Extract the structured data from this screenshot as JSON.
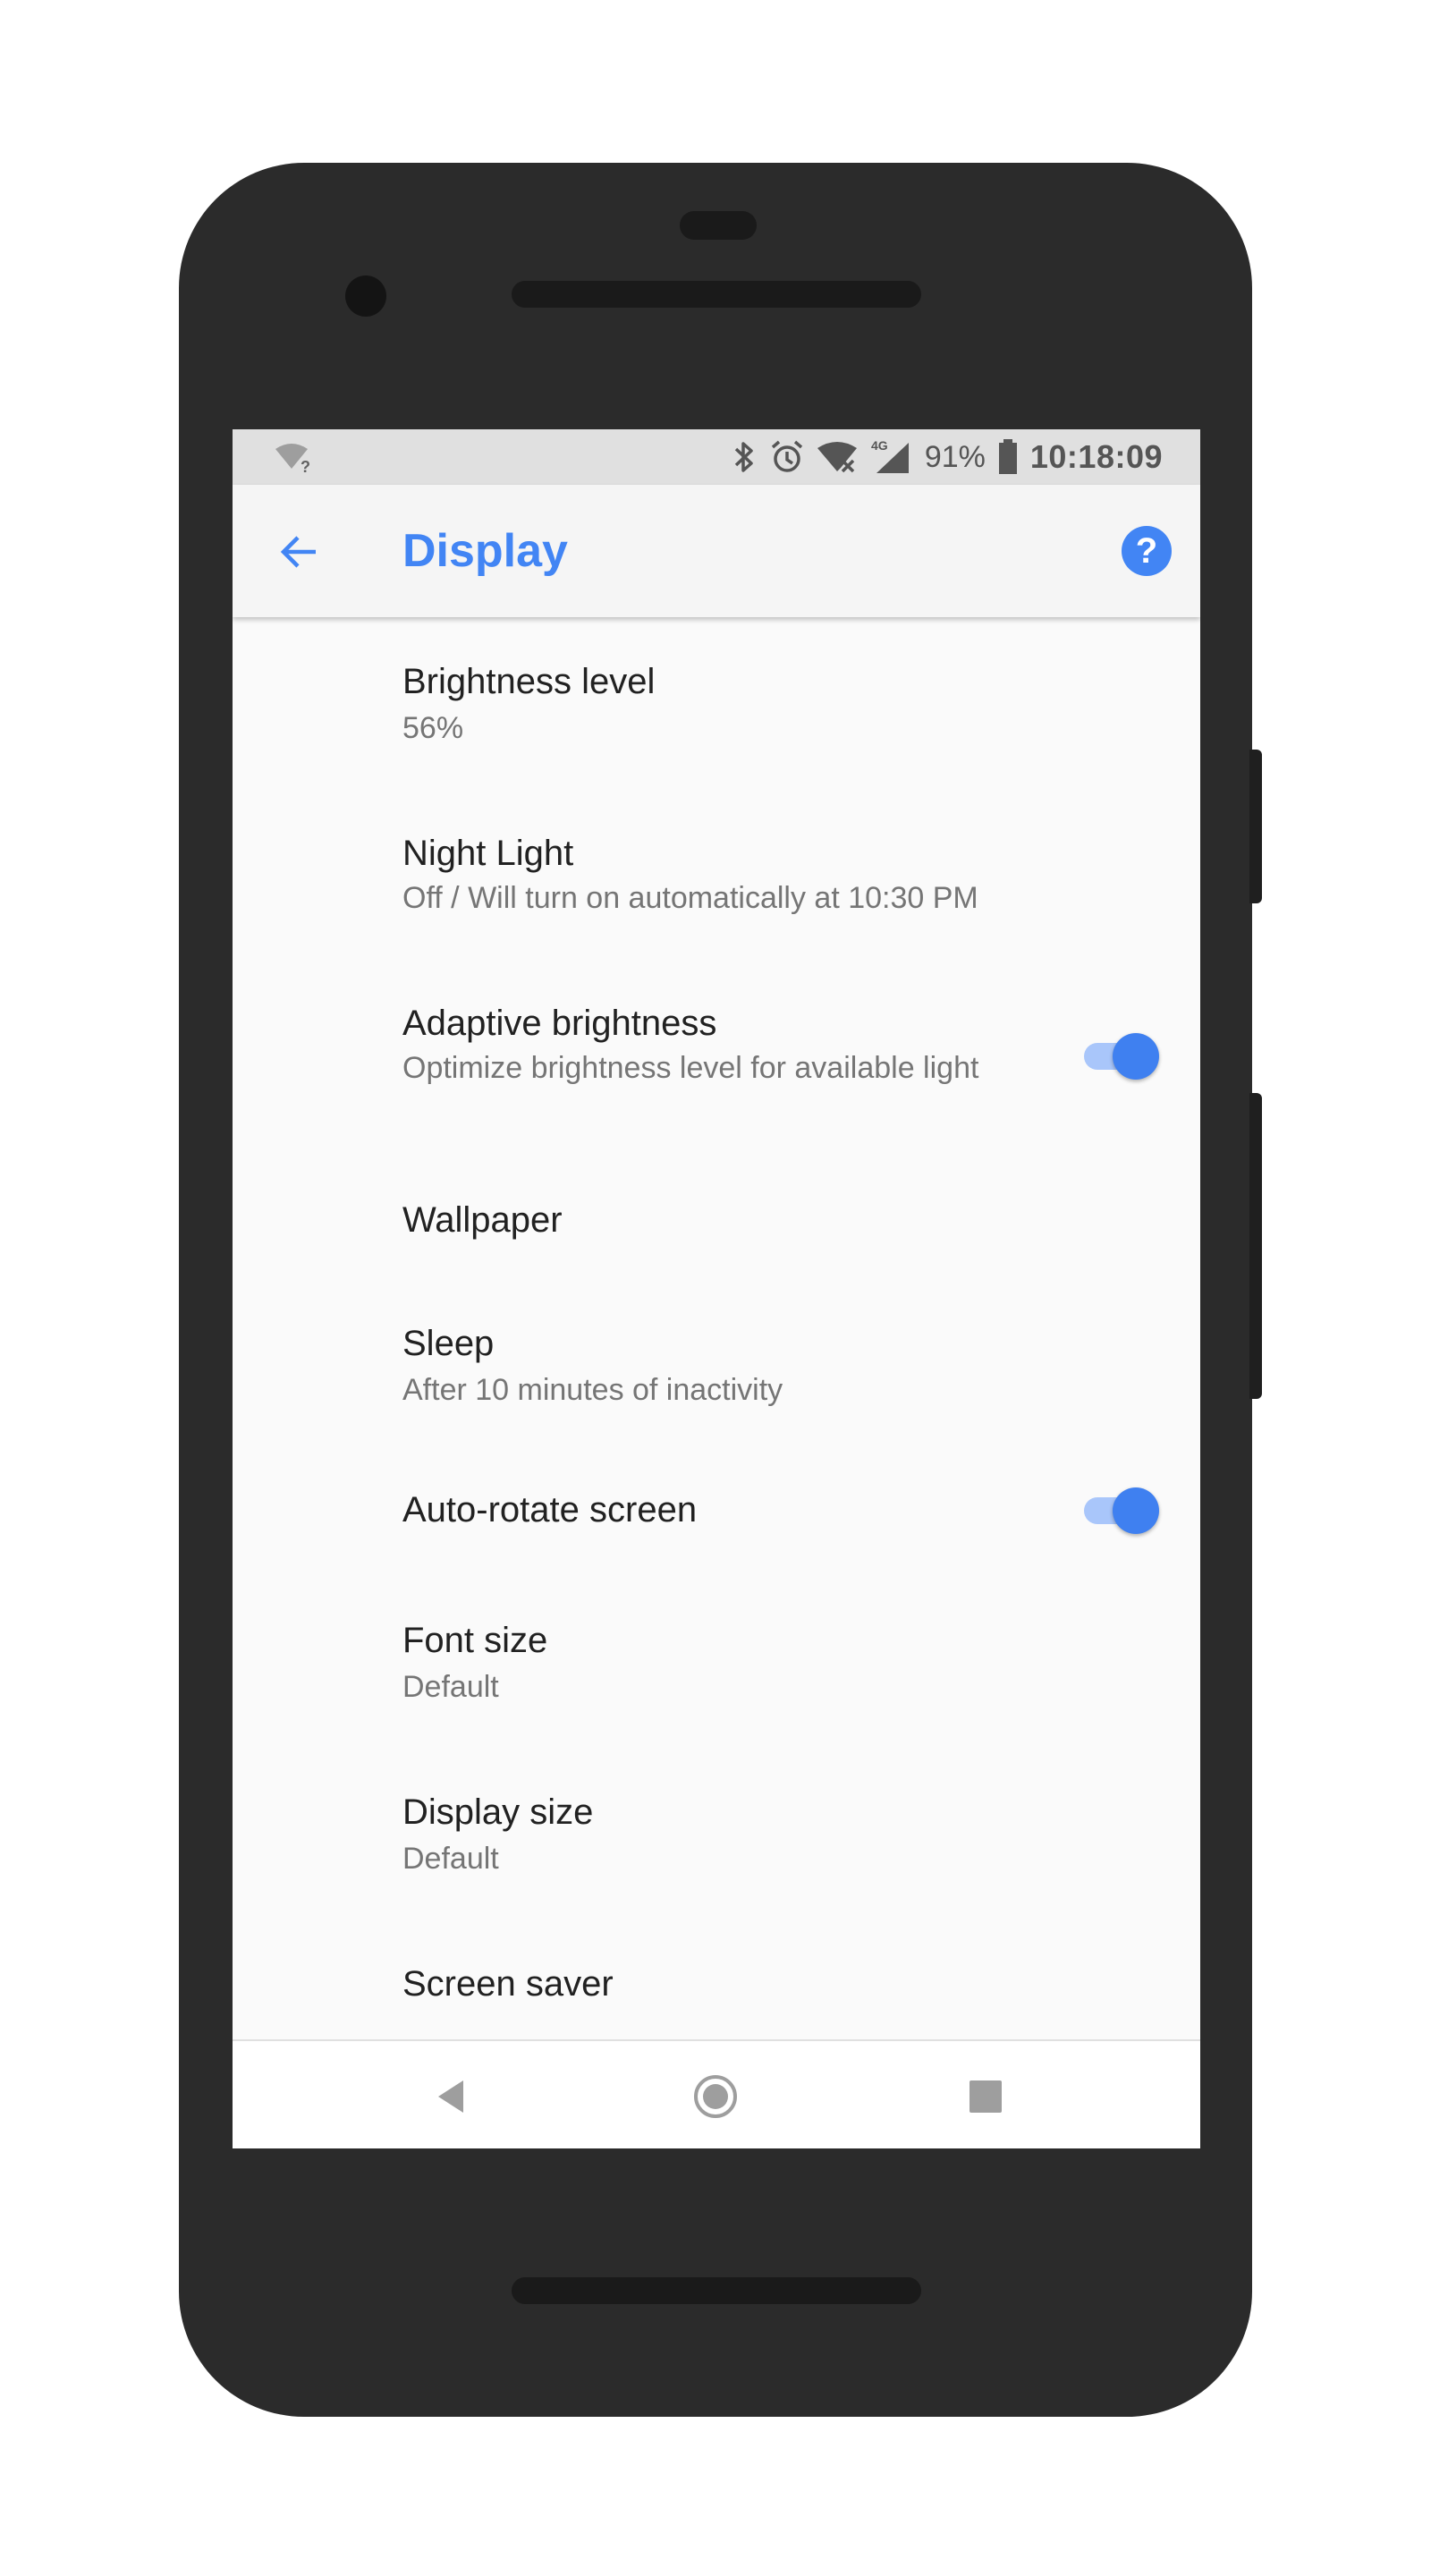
{
  "status_bar": {
    "battery_percent": "91%",
    "time": "10:18:09",
    "network_badge": "4G",
    "icons": [
      "wifi-unknown-icon",
      "bluetooth-icon",
      "alarm-icon",
      "wifi-off-icon",
      "signal-icon",
      "battery-icon"
    ]
  },
  "app_bar": {
    "title": "Display",
    "back_icon": "arrow-back-icon",
    "help_icon": "help-circle-icon",
    "help_glyph": "?"
  },
  "settings": [
    {
      "title": "Brightness level",
      "summary": "56%"
    },
    {
      "title": "Night Light",
      "summary": "Off / Will turn on automatically at 10:30 PM"
    },
    {
      "title": "Adaptive brightness",
      "summary": "Optimize brightness level for available light",
      "toggle": true
    },
    {
      "title": "Wallpaper",
      "summary": ""
    },
    {
      "title": "Sleep",
      "summary": "After 10 minutes of inactivity"
    },
    {
      "title": "Auto-rotate screen",
      "summary": "",
      "toggle": true
    },
    {
      "title": "Font size",
      "summary": "Default"
    },
    {
      "title": "Display size",
      "summary": "Default"
    },
    {
      "title": "Screen saver",
      "summary": ""
    }
  ],
  "nav_bar": {
    "icons": [
      "nav-back-icon",
      "nav-home-icon",
      "nav-recents-icon"
    ]
  },
  "colors": {
    "accent": "#4285f4",
    "status_bar_bg": "#e0e0e0",
    "app_bar_bg": "#f5f5f5",
    "list_bg": "#fafafa",
    "phone_frame": "#2b2b2b",
    "toggle_track_on": "#a9c6fa",
    "toggle_thumb_on": "#3f80f0"
  }
}
